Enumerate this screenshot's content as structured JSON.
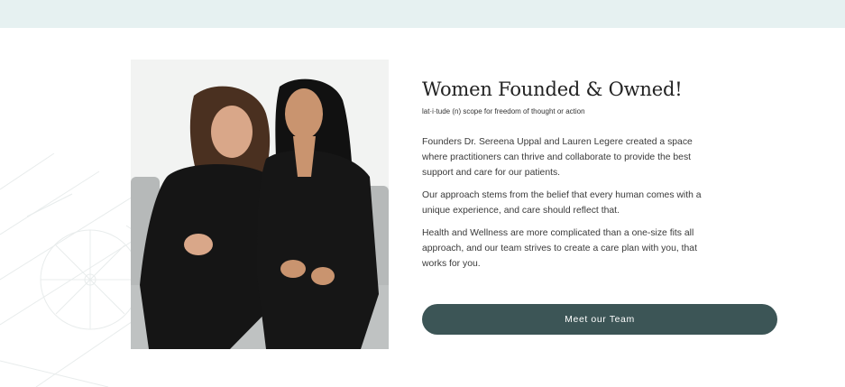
{
  "section": {
    "title": "Women Founded & Owned!",
    "subtitle": "lat·i·tude (n) scope for freedom of thought or action",
    "paragraphs": [
      "Founders Dr. Sereena Uppal and Lauren Legere created a space where practitioners can thrive and collaborate to provide the best support and care for our patients.",
      "Our approach stems from the belief that every human comes with a unique experience, and care should reflect that.",
      "Health and Wellness are more complicated than a one-size fits all approach, and our team strives to create a care plan with you, that works for you."
    ],
    "button_label": "Meet our Team"
  },
  "colors": {
    "top_band": "#e6f1f1",
    "button_bg": "#3c5556",
    "button_text": "#ffffff"
  },
  "icons": [
    "decorative-line-art-icon"
  ]
}
